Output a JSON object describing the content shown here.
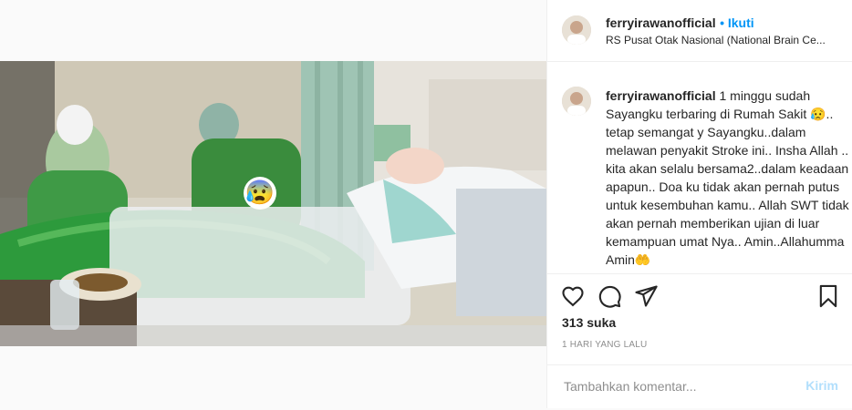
{
  "post": {
    "username": "ferryirawanofficial",
    "follow_label": "• Ikuti",
    "location": "RS Pusat Otak Nasional (National Brain Ce...",
    "caption_username": "ferryirawanofficial",
    "caption_text": " 1 minggu sudah Sayangku terbaring di Rumah Sakit 😥.. tetap semangat y Sayangku..dalam melawan penyakit Stroke ini.. Insha Allah .. kita akan selalu bersama2..dalam keadaan apapun.. Doa ku tidak akan pernah putus untuk kesembuhan kamu.. Allah SWT tidak akan pernah memberikan ujian di luar kemampuan umat Nya.. Amin..Allahumma Amin🤲",
    "likes": "313 suka",
    "timestamp": "1 HARI YANG LALU",
    "comment_placeholder": "Tambahkan komentar...",
    "post_button": "Kirim",
    "photo_sticker": "😰"
  },
  "icons": [
    "heart-icon",
    "comment-icon",
    "share-icon",
    "bookmark-icon"
  ],
  "colors": {
    "accent": "#0095f6",
    "post_disabled": "#b2dffc",
    "muted": "#8e8e8e"
  }
}
